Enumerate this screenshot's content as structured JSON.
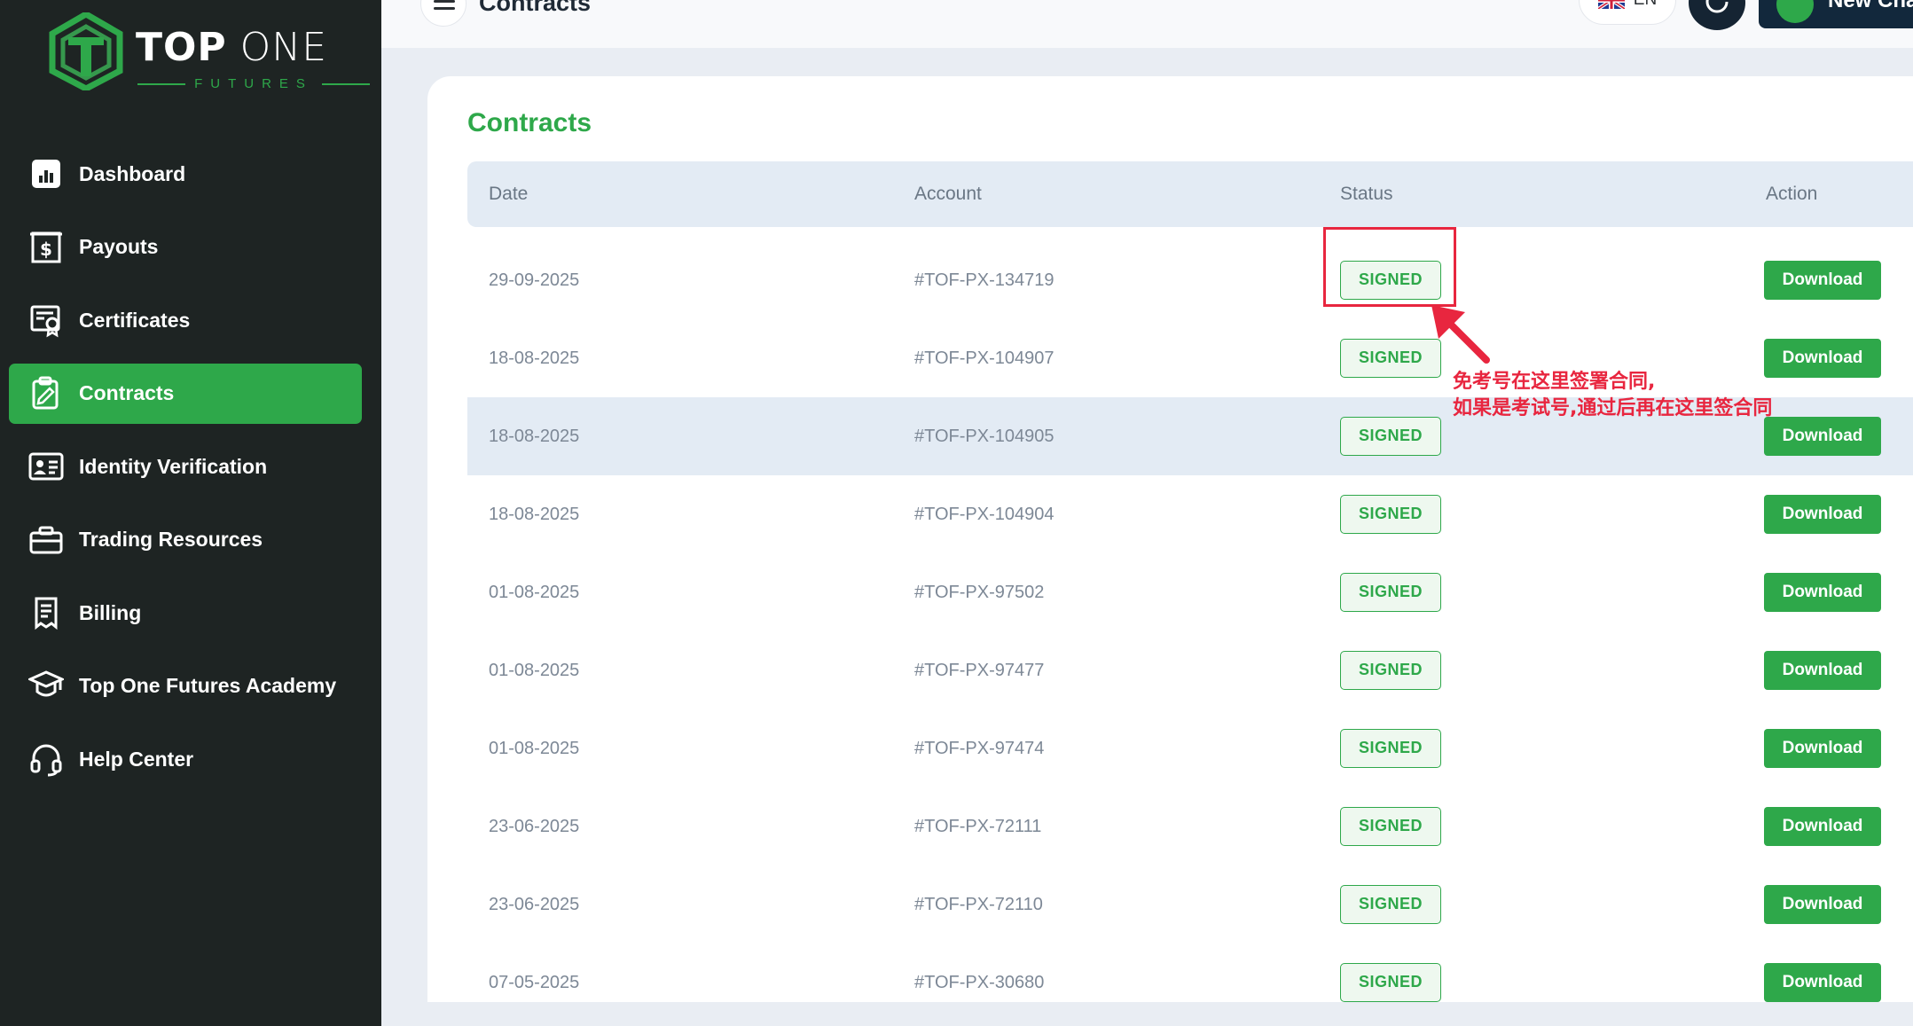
{
  "brand": {
    "name_bold": "TOP",
    "name_light": " ONE",
    "sub": "FUTURES",
    "accent": "#2ea84a",
    "sidebar_bg": "#1e2423"
  },
  "sidebar": {
    "items": [
      {
        "label": "Dashboard",
        "icon": "dashboard-icon",
        "active": false
      },
      {
        "label": "Payouts",
        "icon": "payouts-icon",
        "active": false
      },
      {
        "label": "Certificates",
        "icon": "certificates-icon",
        "active": false
      },
      {
        "label": "Contracts",
        "icon": "contracts-icon",
        "active": true
      },
      {
        "label": "Identity Verification",
        "icon": "id-card-icon",
        "active": false
      },
      {
        "label": "Trading Resources",
        "icon": "briefcase-icon",
        "active": false
      },
      {
        "label": "Billing",
        "icon": "billing-icon",
        "active": false
      },
      {
        "label": "Top One Futures Academy",
        "icon": "graduation-cap-icon",
        "active": false
      },
      {
        "label": "Help Center",
        "icon": "headset-icon",
        "active": false
      }
    ]
  },
  "topbar": {
    "title": "Contracts",
    "language": "EN",
    "new_challenge_label": "New Cha"
  },
  "card": {
    "title": "Contracts",
    "columns": {
      "date": "Date",
      "account": "Account",
      "status": "Status",
      "action": "Action"
    },
    "rows": [
      {
        "date": "29-09-2025",
        "account": "#TOF-PX-134719",
        "status": "SIGNED",
        "action": "Download"
      },
      {
        "date": "18-08-2025",
        "account": "#TOF-PX-104907",
        "status": "SIGNED",
        "action": "Download"
      },
      {
        "date": "18-08-2025",
        "account": "#TOF-PX-104905",
        "status": "SIGNED",
        "action": "Download"
      },
      {
        "date": "18-08-2025",
        "account": "#TOF-PX-104904",
        "status": "SIGNED",
        "action": "Download"
      },
      {
        "date": "01-08-2025",
        "account": "#TOF-PX-97502",
        "status": "SIGNED",
        "action": "Download"
      },
      {
        "date": "01-08-2025",
        "account": "#TOF-PX-97477",
        "status": "SIGNED",
        "action": "Download"
      },
      {
        "date": "01-08-2025",
        "account": "#TOF-PX-97474",
        "status": "SIGNED",
        "action": "Download"
      },
      {
        "date": "23-06-2025",
        "account": "#TOF-PX-72111",
        "status": "SIGNED",
        "action": "Download"
      },
      {
        "date": "23-06-2025",
        "account": "#TOF-PX-72110",
        "status": "SIGNED",
        "action": "Download"
      },
      {
        "date": "07-05-2025",
        "account": "#TOF-PX-30680",
        "status": "SIGNED",
        "action": "Download"
      }
    ]
  },
  "annotation": {
    "line1": "免考号在这里签署合同,",
    "line2": "如果是考试号,通过后再在这里签合同",
    "color": "#e8263f"
  }
}
